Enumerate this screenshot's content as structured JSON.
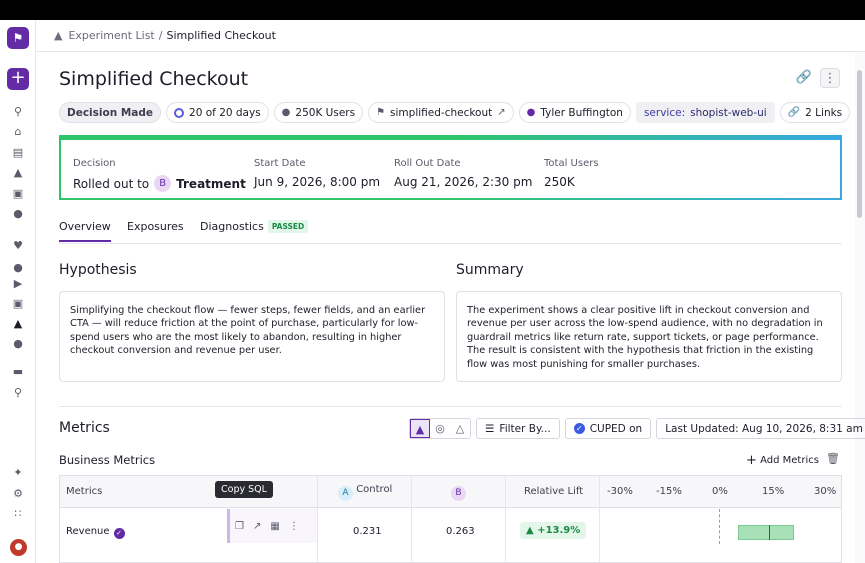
{
  "breadcrumb": {
    "parent": "Experiment List",
    "separator": "/",
    "current": "Simplified Checkout"
  },
  "page": {
    "title": "Simplified Checkout"
  },
  "chips": {
    "status": "Decision Made",
    "days": "20 of 20 days",
    "users": "250K Users",
    "flag": "simplified-checkout",
    "owner": "Tyler Buffington",
    "service_key": "service:",
    "service_value": "shopist-web-ui",
    "links": "2 Links"
  },
  "decision": {
    "label": "Decision",
    "value_prefix": "Rolled out to",
    "variant_letter": "B",
    "variant_name": "Treatment",
    "start_label": "Start Date",
    "start_value": "Jun 9, 2026, 8:00 pm",
    "rollout_label": "Roll Out Date",
    "rollout_value": "Aug 21, 2026, 2:30 pm",
    "total_label": "Total Users",
    "total_value": "250K"
  },
  "tabs": {
    "overview": "Overview",
    "exposures": "Exposures",
    "diagnostics": "Diagnostics",
    "diagnostics_badge": "PASSED"
  },
  "hypothesis": {
    "title": "Hypothesis",
    "text": "Simplifying the checkout flow — fewer steps, fewer fields, and an earlier CTA — will reduce friction at the point of purchase, particularly for low-spend users who are the most likely to abandon, resulting in higher checkout conversion and revenue per user."
  },
  "summary": {
    "title": "Summary",
    "text": "The experiment shows a clear positive lift in checkout conversion and revenue per user across the low-spend audience, with no degradation in guardrail metrics like return rate, support tickets, or page performance. The result is consistent with the hypothesis that friction in the existing flow was most punishing for smaller purchases."
  },
  "metrics": {
    "title": "Metrics",
    "filter": "Filter By...",
    "cuped": "CUPED on",
    "last_updated": "Last Updated: Aug 10, 2026, 8:31 am",
    "section": "Business Metrics",
    "add": "Add Metrics",
    "tooltip": "Copy SQL",
    "columns": {
      "metrics": "Metrics",
      "control_letter": "A",
      "control": "Control",
      "treatment_letter": "B",
      "lift": "Relative Lift",
      "axis": [
        "-30%",
        "-15%",
        "0%",
        "15%",
        "30%"
      ]
    },
    "rows": [
      {
        "name": "Revenue",
        "control": "0.231",
        "treatment": "0.263",
        "lift": "+13.9%",
        "ci_low": 5,
        "ci_high": 21,
        "ci_mid": 14
      }
    ]
  },
  "colors": {
    "brand": "#632ca6",
    "positive": "#1b8a44",
    "highlight_border": "#2ec56a"
  }
}
